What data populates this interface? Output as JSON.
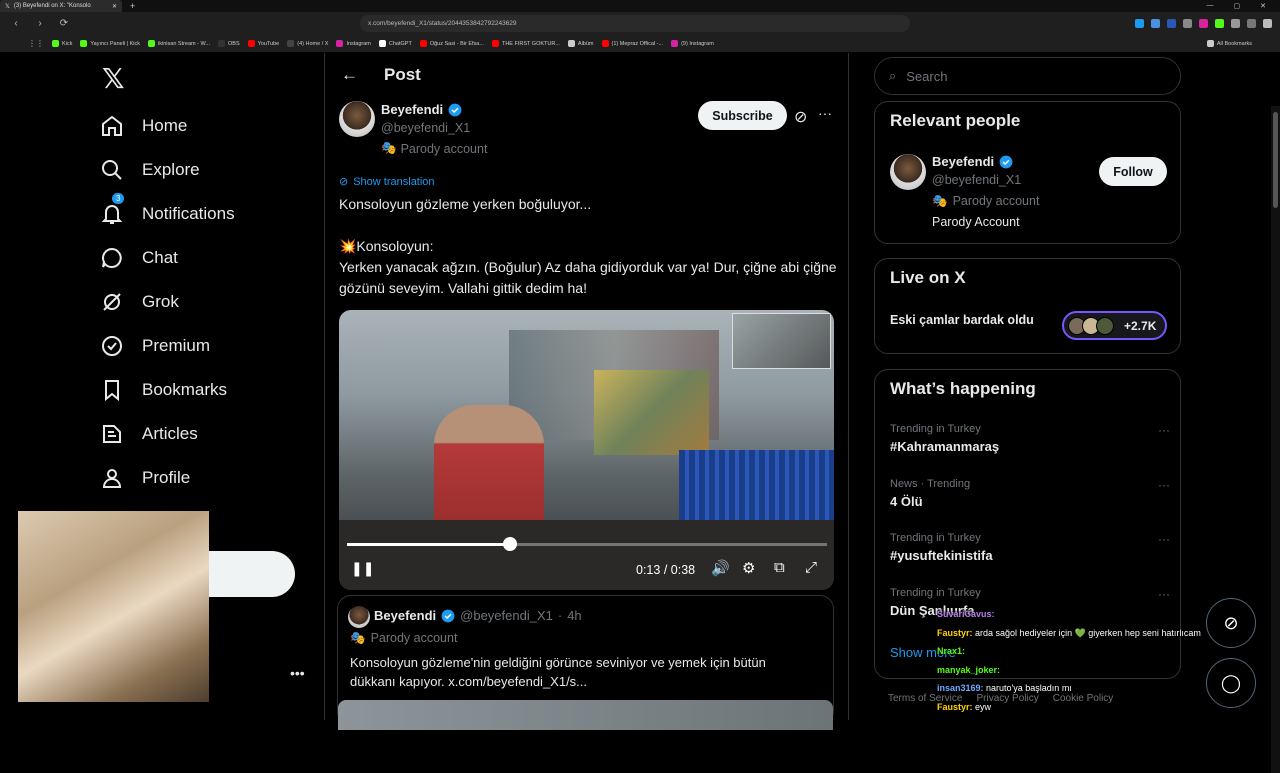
{
  "browser": {
    "tab_title": "(3) Beyefendi on X: \"Konsolo",
    "url": "x.com/beyefendi_X1/status/2044353842792243629",
    "bookmarks": [
      {
        "label": "Kick",
        "color": "#53fc18"
      },
      {
        "label": "Yayıncı Paneli | Kick",
        "color": "#53fc18"
      },
      {
        "label": "ikinisan Stream - W...",
        "color": "#53fc18"
      },
      {
        "label": "OBS",
        "color": "#333333"
      },
      {
        "label": "YouTube",
        "color": "#ff0000"
      },
      {
        "label": "(4) Home / X",
        "color": "#000000"
      },
      {
        "label": "Instagram",
        "color": "#d6249f"
      },
      {
        "label": "ChatGPT",
        "color": "#ffffff"
      },
      {
        "label": "Oğuz Sasi - Bir Efsa...",
        "color": "#ff0000"
      },
      {
        "label": "THE FIRST GOKTUR...",
        "color": "#ff0000"
      },
      {
        "label": "Albüm",
        "color": "#cccccc"
      },
      {
        "label": "(1) Mepraz Offical -...",
        "color": "#ff0000"
      },
      {
        "label": "(9) Instagram",
        "color": "#d6249f"
      }
    ],
    "all_bookmarks": "All Bookmarks"
  },
  "nav": {
    "items": [
      {
        "label": "Home",
        "icon": "home-icon"
      },
      {
        "label": "Explore",
        "icon": "search-icon"
      },
      {
        "label": "Notifications",
        "icon": "bell-icon"
      },
      {
        "label": "Chat",
        "icon": "chat-icon"
      },
      {
        "label": "Grok",
        "icon": "grok-icon"
      },
      {
        "label": "Premium",
        "icon": "verified-icon"
      },
      {
        "label": "Bookmarks",
        "icon": "bookmark-icon"
      },
      {
        "label": "Articles",
        "icon": "article-icon"
      },
      {
        "label": "Profile",
        "icon": "profile-icon"
      }
    ],
    "notification_count": "3"
  },
  "post": {
    "header": "Post",
    "author_name": "Beyefendi",
    "author_handle": "@beyefendi_X1",
    "parody_label": "Parody account",
    "subscribe": "Subscribe",
    "show_translation": "Show translation",
    "text_line1": "Konsoloyun gözleme yerken boğuluyor...",
    "text_line2": "💥Konsoloyun:",
    "text_line3": "Yerken yanacak ağzın. (Boğulur) Az daha gidiyorduk var ya! Dur, çiğne abi çiğne gözünü seveyim. Vallahi gittik dedim ha!",
    "video": {
      "current_time": "0:13",
      "duration": "0:38",
      "progress": 0.34
    },
    "quote": {
      "author_name": "Beyefendi",
      "author_handle": "@beyefendi_X1",
      "time": "4h",
      "parody_label": "Parody account",
      "text": "Konsoloyun gözleme'nin geldiğini görünce seviniyor ve yemek için bütün dükkanı kapıyor.  x.com/beyefendi_X1/s..."
    }
  },
  "sidebar": {
    "search_placeholder": "Search",
    "relevant_people": {
      "title": "Relevant people",
      "name": "Beyefendi",
      "handle": "@beyefendi_X1",
      "parody_label": "Parody account",
      "bio": "Parody Account",
      "follow": "Follow"
    },
    "live": {
      "title": "Live on X",
      "text": "Eski çamlar bardak oldu",
      "count": "+2.7K"
    },
    "happening": {
      "title": "What’s happening",
      "trends": [
        {
          "context": "Trending in Turkey",
          "topic": "#Kahramanmaraş"
        },
        {
          "context": "News · Trending",
          "topic": "4 Ölü"
        },
        {
          "context": "Trending in Turkey",
          "topic": "#yusuftekinistifa"
        },
        {
          "context": "Trending in Turkey",
          "topic": "Dün Şanlıurfa"
        }
      ],
      "show_more": "Show more"
    },
    "footer": [
      "Terms of Service",
      "Privacy Policy",
      "Cookie Policy"
    ]
  },
  "stream_chat": [
    {
      "user": "SuvariCavus:",
      "msg": "",
      "color": "#b37feb"
    },
    {
      "user": "Faustyr:",
      "msg": "arda sağol hediyeler için 💚 giyerken hep seni hatırlıcam",
      "color": "#ffd400"
    },
    {
      "user": "Nrax1:",
      "msg": "",
      "color": "#53fc18"
    },
    {
      "user": "manyak_joker:",
      "msg": "",
      "color": "#53fc18"
    },
    {
      "user": "insan3169:",
      "msg": "naruto'ya başladın mı",
      "color": "#6fa8ff"
    },
    {
      "user": "Faustyr:",
      "msg": "eyw",
      "color": "#ffd400"
    }
  ]
}
